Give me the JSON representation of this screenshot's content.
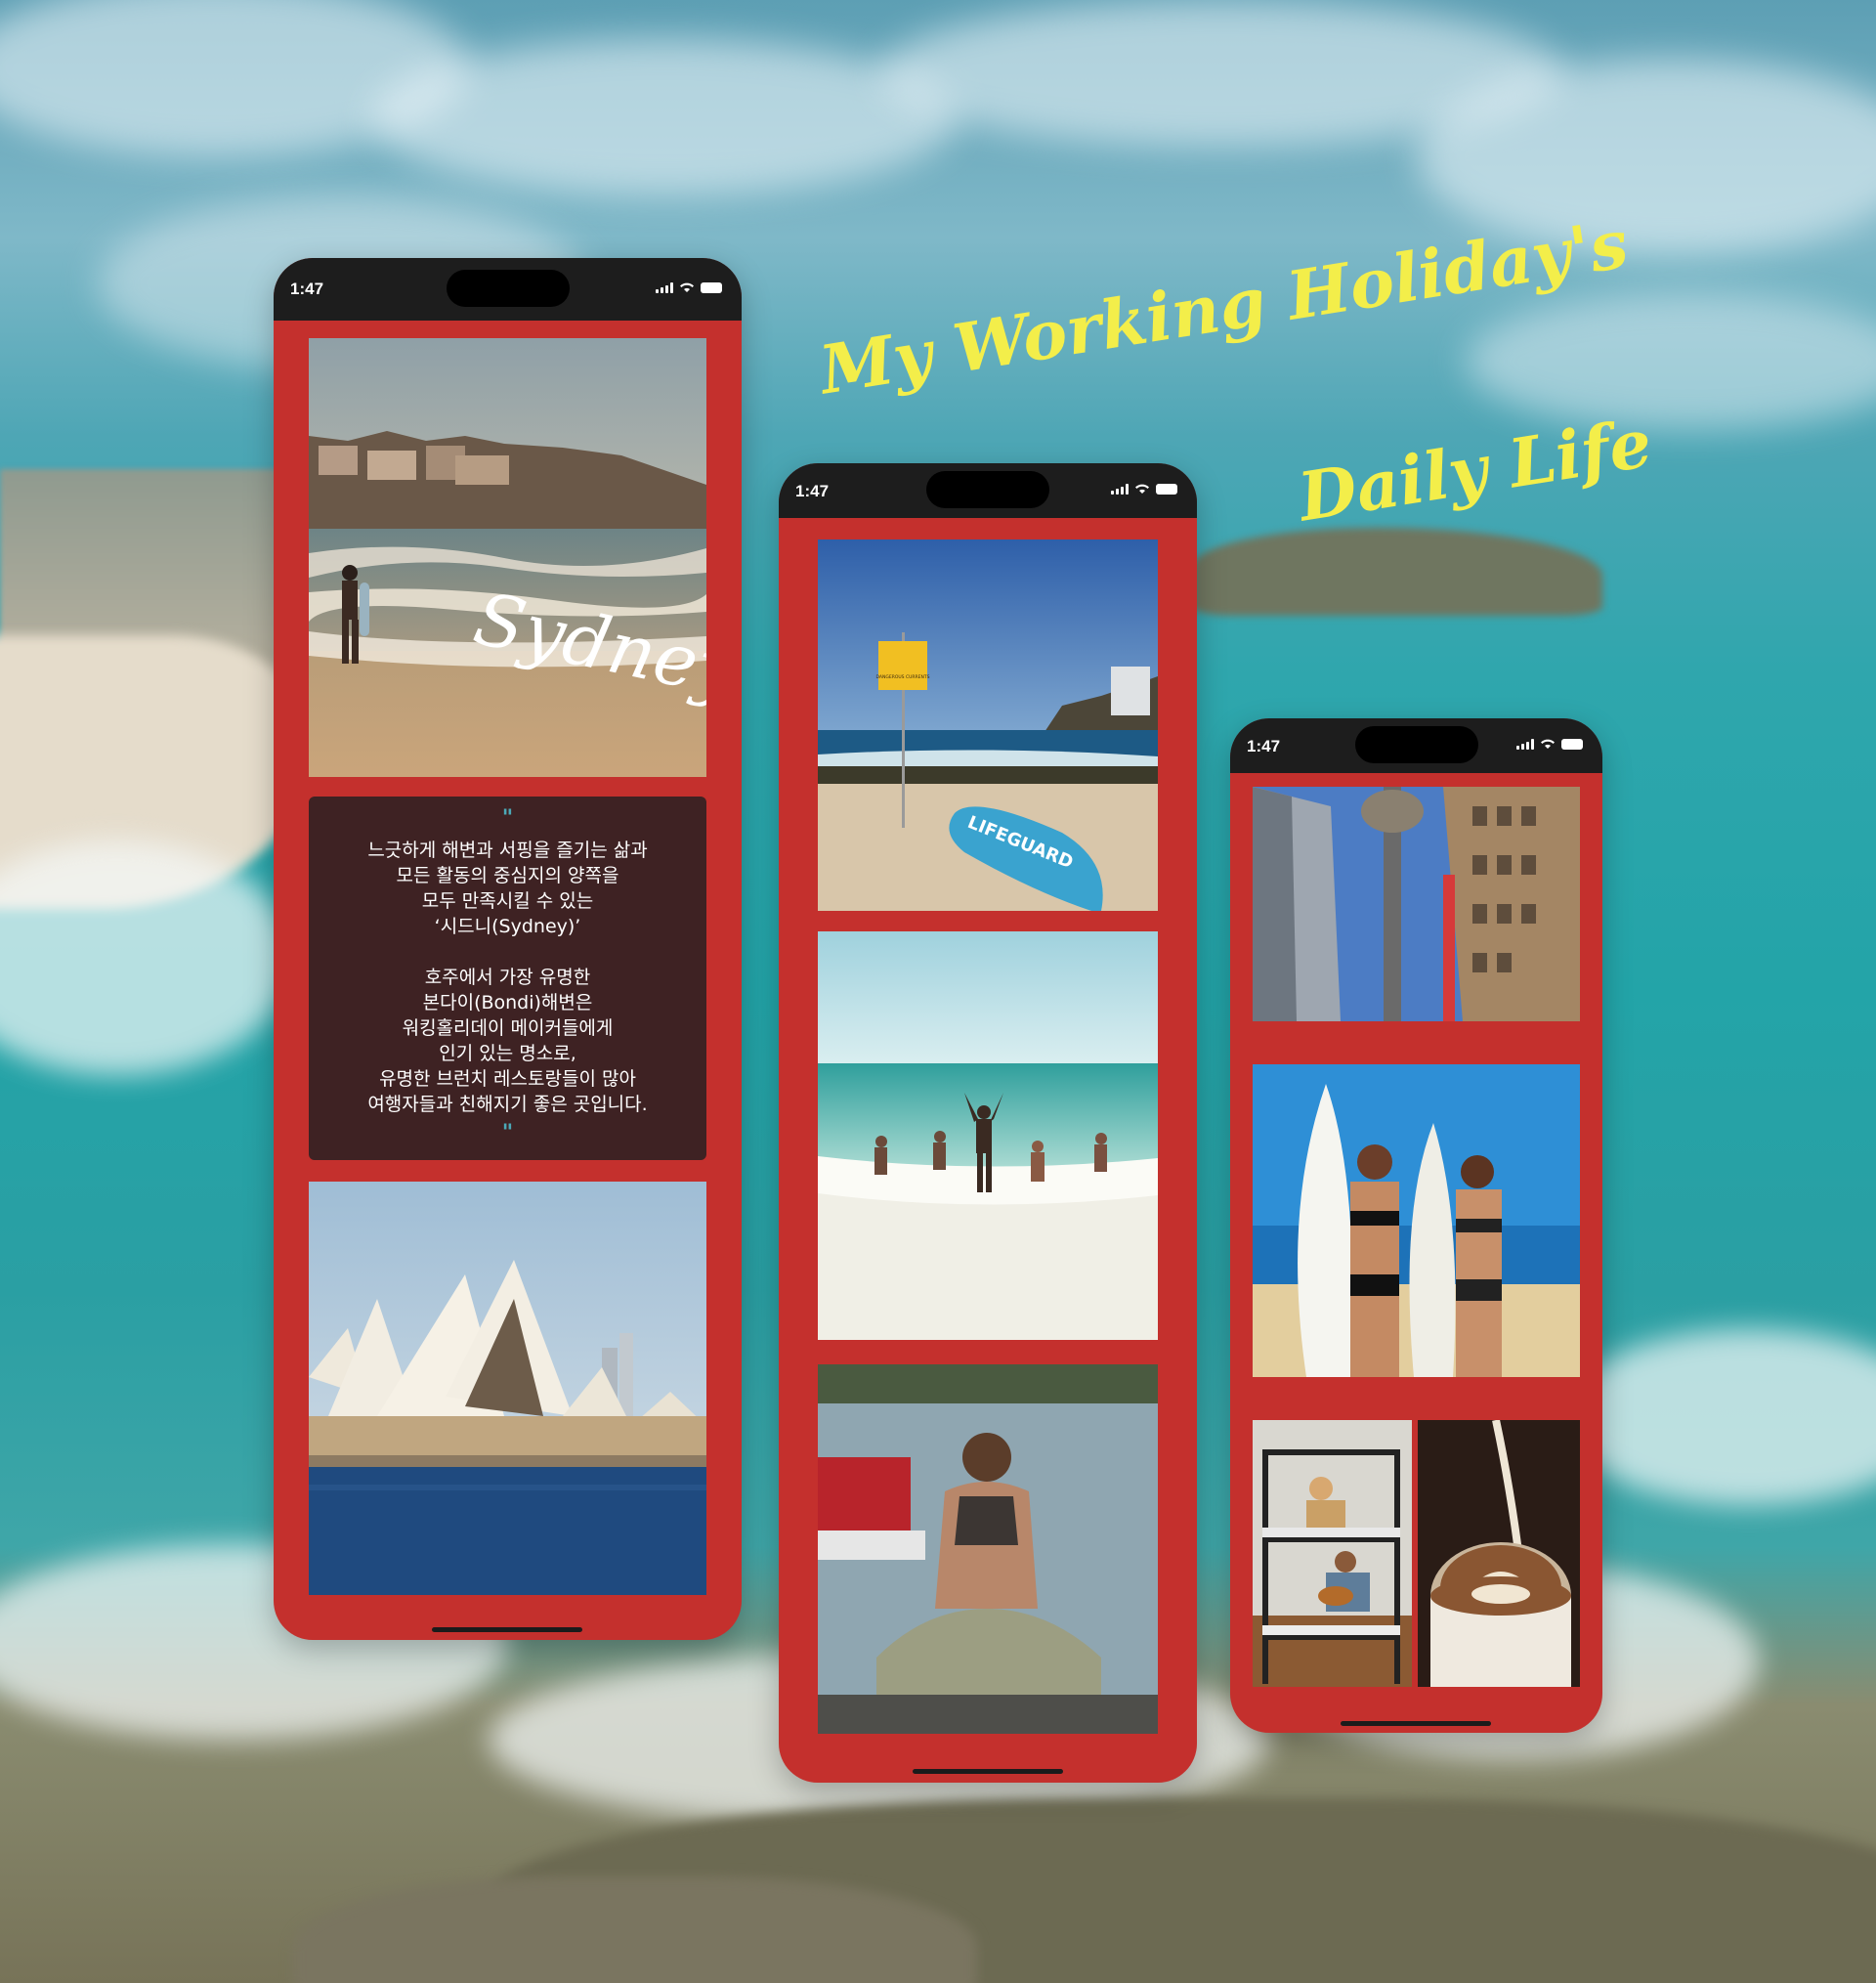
{
  "headline": {
    "line1": "My Working Holiday's",
    "line2": "Daily Life"
  },
  "colors": {
    "phone_frame": "#c4302d",
    "status_bar": "#1d1d1d",
    "text_card": "#3e2223",
    "quote_mark": "#4ba9b7",
    "title": "#f3ee4a"
  },
  "phones": [
    {
      "time": "1:47"
    },
    {
      "time": "1:47"
    },
    {
      "time": "1:47"
    }
  ],
  "sydney_caption": "Sydney",
  "text_card": {
    "open_quote": "\"",
    "para1": [
      "느긋하게 해변과 서핑을 즐기는 삶과",
      "모든 활동의 중심지의 양쪽을",
      "모두 만족시킬 수 있는",
      "‘시드니(Sydney)’"
    ],
    "para2": [
      "호주에서 가장 유명한",
      "본다이(Bondi)해변은",
      "워킹홀리데이 메이커들에게",
      "인기 있는 명소로,",
      "유명한 브런치 레스토랑들이 많아",
      "여행자들과 친해지기 좋은 곳입니다."
    ],
    "close_quote": "\""
  },
  "photo_labels": {
    "sign": "DANGEROUS CURRENTS",
    "board": "LIFEGUARD"
  },
  "icons": [
    "signal-icon",
    "wifi-icon",
    "battery-icon"
  ]
}
